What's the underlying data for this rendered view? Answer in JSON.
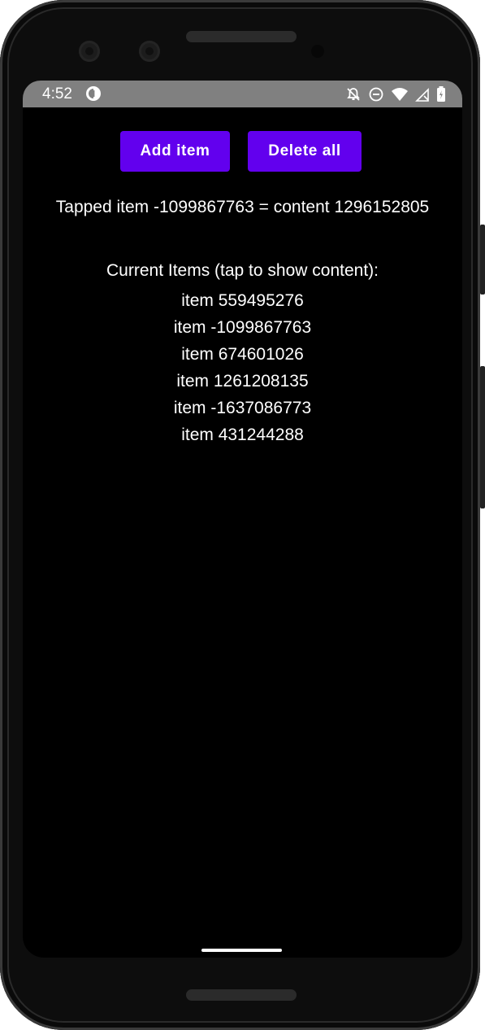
{
  "status_bar": {
    "time": "4:52",
    "icons": [
      "app-notification-icon",
      "notifications-off-icon",
      "do-not-disturb-icon",
      "wifi-icon",
      "signal-icon",
      "battery-icon"
    ]
  },
  "buttons": {
    "add_label": "Add item",
    "delete_label": "Delete all",
    "accent_color": "#6200ee"
  },
  "tapped_text": "Tapped item -1099867763 = content 1296152805",
  "items": {
    "title": "Current Items (tap to show content):",
    "list": [
      "item 559495276",
      "item -1099867763",
      "item 674601026",
      "item 1261208135",
      "item -1637086773",
      "item 431244288"
    ]
  }
}
